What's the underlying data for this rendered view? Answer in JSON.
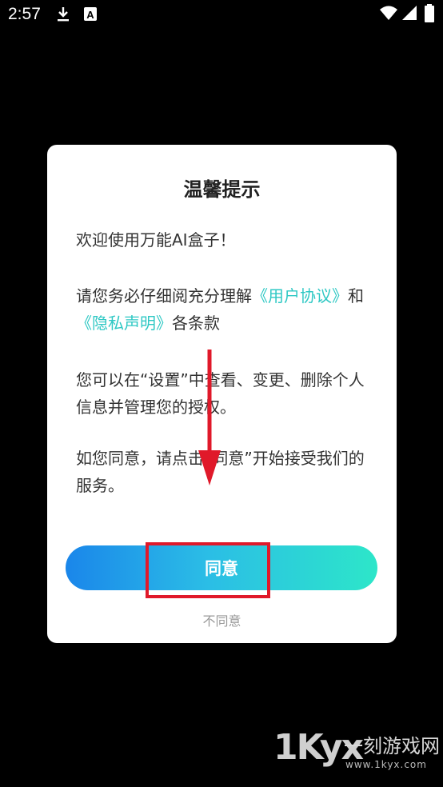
{
  "status_bar": {
    "time": "2:57",
    "icons": [
      "download-icon",
      "keyboard-a-icon",
      "wifi-icon",
      "signal-icon",
      "battery-icon"
    ]
  },
  "dialog": {
    "title": "温馨提示",
    "welcome": "欢迎使用万能AI盒子！",
    "notice_prefix": "请您务必仔细阅充分理解",
    "user_agreement_link": "《用户协议》",
    "notice_and": "和",
    "privacy_link": "《隐私声明》",
    "notice_suffix": "各条款",
    "settings_info": "您可以在“设置”中查看、变更、删除个人信息并管理您的授权。",
    "consent_info": "如您同意，请点击“同意”开始接受我们的服务。",
    "agree_label": "同意",
    "disagree_label": "不同意"
  },
  "watermark": {
    "logo": "1Kyx",
    "site_name": "一刻游戏网",
    "url": "www.1kyx.com"
  },
  "colors": {
    "link": "#2ec8c4",
    "annotation": "#e0192a",
    "button_gradient_start": "#1a86ea",
    "button_gradient_end": "#2de6c9"
  }
}
